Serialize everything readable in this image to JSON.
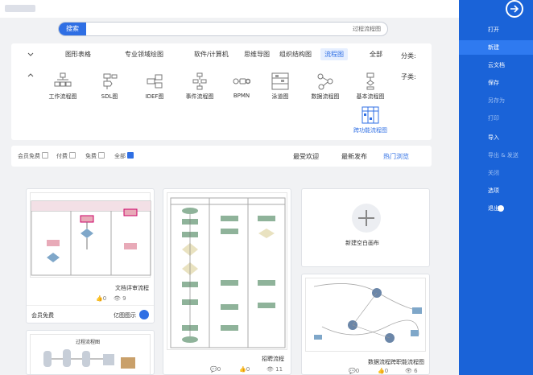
{
  "topbar": {
    "search_button": "搜索",
    "search_placeholder": "过程流程图"
  },
  "categories": {
    "label": "分类:",
    "items": [
      "全部",
      "流程图",
      "组织结构图",
      "思维导图",
      "软件/计算机",
      "专业领域绘图",
      "图形表格"
    ],
    "active": "流程图"
  },
  "subcategories": {
    "label": "子类:",
    "items": [
      "基本流程图",
      "数据流程图",
      "泳道图",
      "BPMN",
      "事件流程图",
      "IDEF图",
      "SDL图",
      "工作流程图",
      "跨功能流程图"
    ],
    "active": "跨功能流程图"
  },
  "filter": {
    "tabs": [
      "热门浏览",
      "最新发布",
      "最受欢迎"
    ],
    "active_tab": "热门浏览",
    "checkboxes": [
      {
        "label": "全部",
        "checked": true
      },
      {
        "label": "免费",
        "checked": false
      },
      {
        "label": "付费",
        "checked": false
      },
      {
        "label": "会员免费",
        "checked": false
      }
    ]
  },
  "cards": {
    "new_blank": "新建空白画布",
    "card1": {
      "title": "文档评审流程",
      "views": "9",
      "likes": "0",
      "tag": "亿图图示",
      "badge": "会员免费"
    },
    "card2": {
      "title": "招聘流程",
      "views": "11",
      "likes": "0",
      "comments": "0"
    },
    "card3": {
      "title": "数据流程跨职能流程图",
      "views": "6",
      "likes": "0",
      "comments": "0"
    },
    "card4": {
      "title": "过程流程图"
    }
  },
  "sidebar": {
    "items": [
      {
        "label": "打开",
        "dim": false
      },
      {
        "label": "新建",
        "dim": false,
        "active": true
      },
      {
        "label": "云文档",
        "dim": false
      },
      {
        "label": "保存",
        "dim": false
      },
      {
        "label": "另存为",
        "dim": true
      },
      {
        "label": "打印",
        "dim": true
      },
      {
        "label": "导入",
        "dim": false
      },
      {
        "label": "导出 & 发送",
        "dim": true
      },
      {
        "label": "关闭",
        "dim": true
      },
      {
        "label": "选项",
        "dim": false
      },
      {
        "label": "退出",
        "dim": false
      }
    ]
  },
  "colors": {
    "accent": "#2f6fe4",
    "sidebar": "#1a63d8"
  }
}
